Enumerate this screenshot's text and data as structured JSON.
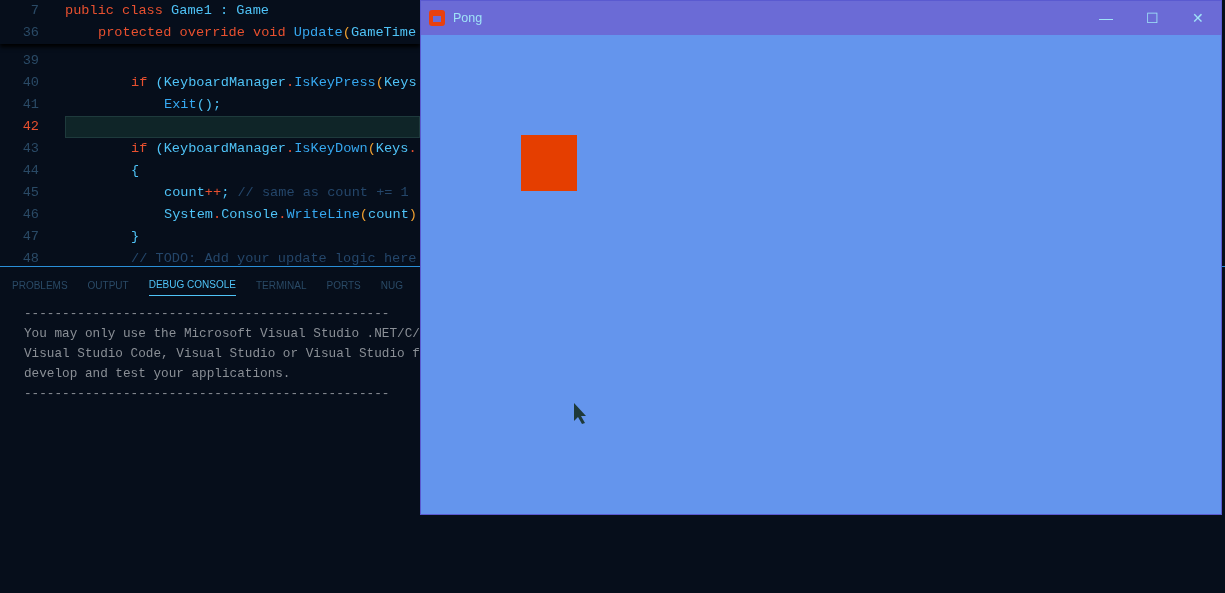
{
  "editor": {
    "outline": [
      {
        "number": "7",
        "tokens": [
          {
            "text": "public class ",
            "kind": "keyword"
          },
          {
            "text": "Game1 : Game",
            "kind": "type"
          }
        ],
        "children": [
          {
            "number": "36",
            "tokens": [
              {
                "text": "protected override void ",
                "kind": "keyword"
              },
              {
                "text": "Update",
                "kind": "function"
              },
              {
                "text": "(",
                "kind": "paren"
              },
              {
                "text": "GameTime",
                "kind": "type"
              }
            ],
            "children": [
              {
                "number": "39",
                "current": false
              },
              {
                "number": "40",
                "current": false,
                "tokens": [
                  {
                    "text": "if ",
                    "kind": "keyword"
                  },
                  {
                    "text": "(",
                    "kind": "bracket"
                  },
                  {
                    "text": "KeyboardManager",
                    "kind": "type"
                  },
                  {
                    "text": ".",
                    "kind": "operator"
                  },
                  {
                    "text": "IsKeyPress",
                    "kind": "function"
                  },
                  {
                    "text": "(",
                    "kind": "paren"
                  },
                  {
                    "text": "Keys",
                    "kind": "type"
                  }
                ],
                "children": [
                  {
                    "number": "41",
                    "current": false,
                    "tokens": [
                      {
                        "text": "Exit",
                        "kind": "function"
                      },
                      {
                        "text": "();",
                        "kind": "bracket"
                      }
                    ]
                  }
                ]
              },
              {
                "number": "42",
                "current": true
              },
              {
                "number": "43",
                "current": false,
                "tokens": [
                  {
                    "text": "if ",
                    "kind": "keyword"
                  },
                  {
                    "text": "(",
                    "kind": "bracket"
                  },
                  {
                    "text": "KeyboardManager",
                    "kind": "type"
                  },
                  {
                    "text": ".",
                    "kind": "operator"
                  },
                  {
                    "text": "IsKeyDown",
                    "kind": "function"
                  },
                  {
                    "text": "(",
                    "kind": "paren"
                  },
                  {
                    "text": "Keys",
                    "kind": "type"
                  },
                  {
                    "text": ".",
                    "kind": "operator"
                  }
                ]
              },
              {
                "number": "44",
                "current": false,
                "tokens": [
                  {
                    "text": "{",
                    "kind": "bracket"
                  }
                ],
                "children": [
                  {
                    "number": "45",
                    "current": false,
                    "tokens": [
                      {
                        "text": "count",
                        "kind": "type"
                      },
                      {
                        "text": "++",
                        "kind": "operator"
                      },
                      {
                        "text": "; ",
                        "kind": "bracket"
                      },
                      {
                        "text": "// same as count += 1",
                        "kind": "comment"
                      }
                    ]
                  },
                  {
                    "number": "46",
                    "current": false,
                    "tokens": [
                      {
                        "text": "System",
                        "kind": "type"
                      },
                      {
                        "text": ".",
                        "kind": "operator"
                      },
                      {
                        "text": "Console",
                        "kind": "type"
                      },
                      {
                        "text": ".",
                        "kind": "operator"
                      },
                      {
                        "text": "WriteLine",
                        "kind": "function"
                      },
                      {
                        "text": "(",
                        "kind": "paren"
                      },
                      {
                        "text": "count",
                        "kind": "type"
                      },
                      {
                        "text": ")",
                        "kind": "paren"
                      }
                    ]
                  }
                ]
              },
              {
                "number": "47",
                "current": false,
                "tokens": [
                  {
                    "text": "}",
                    "kind": "bracket"
                  }
                ]
              },
              {
                "number": "48",
                "current": false,
                "tokens": [
                  {
                    "text": "// TODO: Add your update logic here",
                    "kind": "comment"
                  }
                ]
              }
            ]
          }
        ]
      }
    ]
  },
  "panel": {
    "tabs": [
      {
        "label": "PROBLEMS",
        "selected": false
      },
      {
        "label": "OUTPUT",
        "selected": false
      },
      {
        "label": "DEBUG CONSOLE",
        "selected": true
      },
      {
        "label": "TERMINAL",
        "selected": false
      },
      {
        "label": "PORTS",
        "selected": false
      },
      {
        "label": "NUG",
        "selected": false
      }
    ],
    "console_lines": [
      "------------------------------------------------",
      "You may only use the Microsoft Visual Studio .NET/C/",
      "Visual Studio Code, Visual Studio or Visual Studio f",
      "develop and test your applications.",
      "------------------------------------------------"
    ]
  },
  "game_window": {
    "title": "Pong",
    "buttons": [
      "—",
      "☐",
      "✕"
    ]
  }
}
